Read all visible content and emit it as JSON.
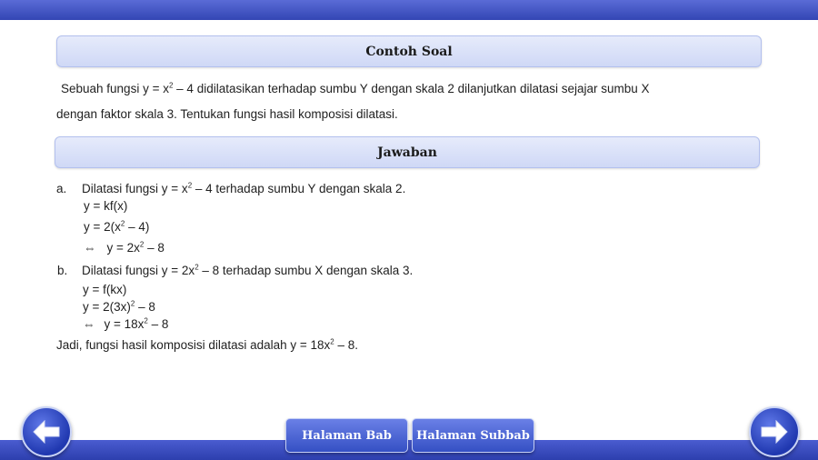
{
  "contoh_soal": {
    "title": "Contoh Soal",
    "line1_pre": "Sebuah fungsi y = x",
    "line1_sup": "2",
    "line1_post": " – 4 didilatasikan terhadap  sumbu Y dengan skala 2  dilanjutkan dilatasi sejajar sumbu X",
    "line2": "dengan faktor skala 3. Tentukan fungsi  hasil komposisi dilatasi."
  },
  "jawaban": {
    "title": "Jawaban",
    "a_label": "a.",
    "a_pre": "Dilatasi fungsi y = x",
    "a_sup": "2",
    "a_post": " – 4 terhadap  sumbu Y dengan skala 2.",
    "a_step1": "y = kf(x)",
    "a_step2_pre": "y = 2(x",
    "a_step2_sup": "2",
    "a_step2_post": " – 4)",
    "a_step3_arrow": "⇔",
    "a_step3_pre": "y = 2x",
    "a_step3_sup": "2",
    "a_step3_post": " – 8",
    "b_label": "b.",
    "b_pre": "Dilatasi fungsi y = 2x",
    "b_sup": "2",
    "b_post": " – 8 terhadap  sumbu X dengan skala 3.",
    "b_step1": "y = f(kx)",
    "b_step2_pre": "y = 2(3x)",
    "b_step2_sup": "2",
    "b_step2_post": " – 8",
    "b_step3_arrow": "⇔",
    "b_step3_pre": "y = 18x",
    "b_step3_sup": "2",
    "b_step3_post": " – 8",
    "conclusion_pre": "Jadi, fungsi hasil komposisi dilatasi adalah y = 18x",
    "conclusion_sup": "2",
    "conclusion_post": " – 8."
  },
  "buttons": {
    "halaman_bab": "Halaman Bab",
    "halaman_subbab": "Halaman Subbab"
  },
  "icons": {
    "prev": "arrow-left-icon",
    "next": "arrow-right-icon"
  },
  "colors": {
    "bar": "#3346b4",
    "header_bg": "#d9e0f8",
    "button": "#3550c4"
  }
}
